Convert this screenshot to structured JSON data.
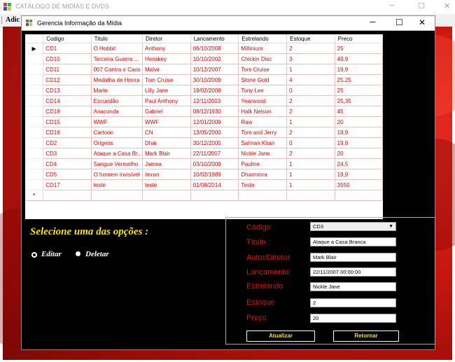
{
  "outer_window": {
    "title": "CATÁLOGO DE MIDIAS E DVDS",
    "menu_label": "Adic"
  },
  "child_window": {
    "title": "Gerencia Informação da Mídia"
  },
  "grid": {
    "columns": [
      "Codigo",
      "Titulo",
      "Diretor",
      "Lancamento",
      "Estrelando",
      "Estoque",
      "Preco"
    ],
    "rows": [
      [
        "CD1",
        "O Hobbit",
        "Anthony",
        "06/10/2008",
        "Millinium",
        "2",
        "25"
      ],
      [
        "CD10",
        "Terceira Guerra ...",
        "Henskey",
        "10/10/2002",
        "Chickin Disc",
        "3",
        "49,9"
      ],
      [
        "CD11",
        "007 Contra o Caos",
        "Malvir",
        "10/12/2007",
        "Tom Cruise",
        "1",
        "19,9"
      ],
      [
        "CD12",
        "Medalha de Honra",
        "Tom Cruise",
        "30/10/2009",
        "Stone Gold",
        "4",
        "25,25"
      ],
      [
        "CD13",
        "Marte",
        "Lilly Jane",
        "19/02/2008",
        "Tony Lee",
        "0",
        "25"
      ],
      [
        "CD14",
        "Escuridão",
        "Paul Anthony",
        "12/11/2003",
        "Yearwood",
        "2",
        "25,35"
      ],
      [
        "CD18",
        "Anaconda",
        "Gabriel",
        "08/12/1930",
        "Halk Nelson",
        "2",
        "45"
      ],
      [
        "CD15",
        "WWF",
        "WWF",
        "12/01/2009",
        "Raw",
        "1",
        "20"
      ],
      [
        "CD16",
        "Cartoon",
        "CN",
        "13/05/2000",
        "Tom and Jerry",
        "2",
        "19,9"
      ],
      [
        "CD2",
        "Origens",
        "Dhar",
        "30/12/2005",
        "Salman Khan",
        "0",
        "19,9"
      ],
      [
        "CD3",
        "Ataque a Casa Br...",
        "Mark Blair",
        "22/11/2007",
        "Nickle Jane",
        "2",
        "20"
      ],
      [
        "CD4",
        "Sangue Vermelho",
        "Jamea",
        "03/10/2009",
        "Pauline",
        "1",
        "24,5"
      ],
      [
        "CD5",
        "O homem invisível",
        "Imran",
        "10/02/1989",
        "Dharminra",
        "1",
        "19,9"
      ],
      [
        "CD17",
        "teste",
        "teste",
        "01/08/2014",
        "Teste",
        "1",
        "3550"
      ]
    ],
    "current_row_marker": "▶",
    "new_row_marker": "*"
  },
  "options": {
    "title": "Selecione uma das opções :",
    "edit_label": "Editar",
    "delete_label": "Deletar"
  },
  "form": {
    "codigo_label": "Código",
    "codigo_value": "CD3",
    "titulo_label": "Título :",
    "titulo_value": "Ataque a Casa Branca",
    "autor_label": "Autor/Diretor",
    "autor_value": "Mark Blair",
    "lancamento_label": "Lançamento:",
    "lancamento_value": "22/11/2007 00:00:00",
    "estrelando_label": "Estrelando",
    "estrelando_value": "Nickle Jane",
    "estoque_label": "Estoque",
    "estoque_value": "2",
    "preco_label": "Preço",
    "preco_value": "20",
    "update_button": "Atualizar",
    "return_button": "Retornar"
  },
  "colors": {
    "cell_text": "#e00000",
    "label_red": "#e01010",
    "accent_yellow": "#f5e01a",
    "panel_bg": "#000000",
    "background_red": "#d11a12"
  }
}
